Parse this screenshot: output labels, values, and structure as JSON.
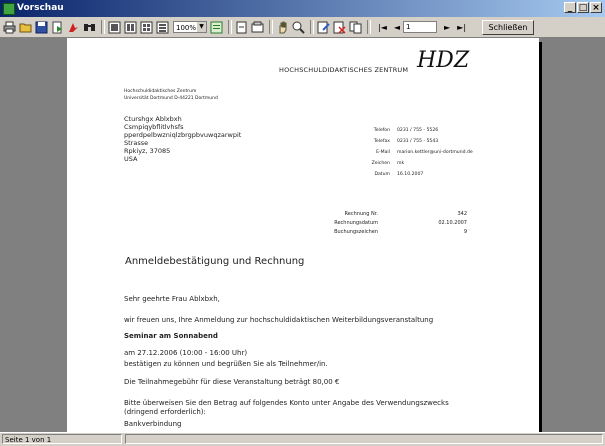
{
  "window": {
    "title": "Vorschau",
    "minimize": "_",
    "maximize": "□",
    "close": "×"
  },
  "toolbar": {
    "zoom_value": "100%",
    "page_value": "1",
    "nav_first": "|◄",
    "nav_prev": "◄",
    "nav_next": "►",
    "nav_last": "►|",
    "close_label": "Schließen"
  },
  "document": {
    "header_org": "HOCHSCHULDIDAKTISCHES ZENTRUM",
    "logo_text": "HDZ",
    "sender_line1": "Hochschuldidaktisches Zentrum",
    "sender_line2": "Universität Dortmund D-44221 Dortmund",
    "recipient": [
      "Cturshgx Ablxbxh",
      "Csmpiqybflitlvhsfs",
      "pperdpelbwzniqlzbrgpbvuwqzarwpit",
      "Strasse",
      "Rpkiyz, 37085",
      "USA"
    ],
    "info": [
      {
        "label": "Telefon",
        "value": "0231 / 755 - 5526"
      },
      {
        "label": "Telefax",
        "value": "0231 / 755 - 5543"
      },
      {
        "label": "E-Mail",
        "value": "marion.kettler@uni-dortmund.de"
      },
      {
        "label": "Zeichen",
        "value": "mk"
      },
      {
        "label": "Datum",
        "value": "16.10.2007"
      }
    ],
    "refs": [
      {
        "label": "Rechnung Nr.",
        "value": "342"
      },
      {
        "label": "Rechnungsdatum",
        "value": "02.10.2007"
      },
      {
        "label": "Buchungszeichen",
        "value": "9"
      }
    ],
    "heading": "Anmeldebestätigung und Rechnung",
    "salutation": "Sehr geehrte Frau Ablxbxh,",
    "intro": "wir freuen uns, Ihre Anmeldung zur hochschuldidaktischen Weiterbildungsveranstaltung",
    "seminar": "Seminar am Sonnabend",
    "date_time": "am 27.12.2006 (10:00 - 16:00 Uhr)",
    "confirm": "bestätigen zu können und begrüßen Sie als Teilnehmer/in.",
    "fee": "Die Teilnahmegebühr für diese Veranstaltung beträgt  80,00 €",
    "transfer1": "Bitte überweisen Sie den Betrag auf folgendes Konto unter Angabe des Verwendungszwecks",
    "transfer2": "(dringend erforderlich):",
    "bank_label": "Bankverbindung"
  },
  "status": {
    "page_text": "Seite 1 von 1"
  }
}
